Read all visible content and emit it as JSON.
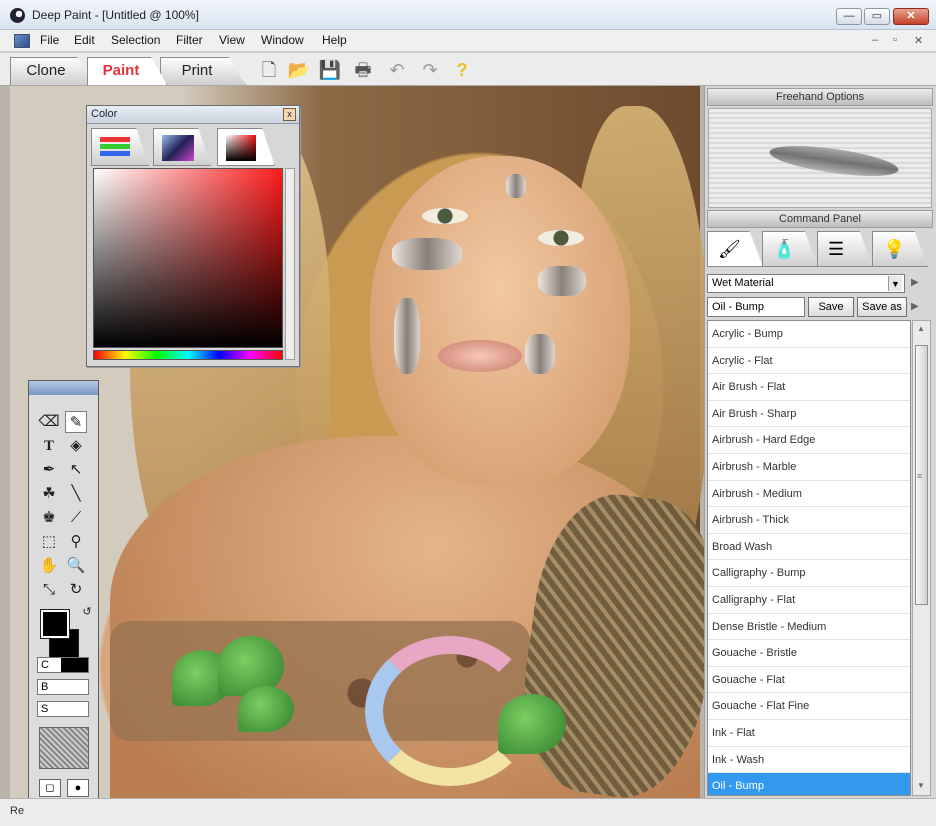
{
  "window": {
    "title": "Deep Paint - [Untitled @ 100%]",
    "minimize_label": "—",
    "maximize_label": "▭",
    "close_label": "✕"
  },
  "menu": {
    "items": [
      "File",
      "Edit",
      "Selection",
      "Filter",
      "View",
      "Window",
      "Help"
    ],
    "mdi_controls": [
      "–",
      "▫",
      "✕"
    ]
  },
  "tabs": [
    {
      "label": "Clone",
      "active": false
    },
    {
      "label": "Paint",
      "active": true
    },
    {
      "label": "Print",
      "active": false
    }
  ],
  "toolbar_icons": [
    "new-document-icon",
    "open-folder-icon",
    "save-icon",
    "print-icon",
    "undo-icon",
    "redo-icon",
    "help-icon"
  ],
  "color_panel": {
    "title": "Color",
    "close_label": "x",
    "tabs": [
      "rgb-sliders-icon",
      "color-wheel-icon",
      "color-square-icon"
    ]
  },
  "tools_panel": {
    "tools": [
      "eraser-icon",
      "brush-icon",
      "text-icon",
      "fill-bucket-icon",
      "pen-icon",
      "arrow-select-icon",
      "smudge-icon",
      "line-icon",
      "stamp-icon",
      "eyedropper-icon",
      "marquee-icon",
      "wand-icon",
      "hand-icon",
      "zoom-icon",
      "transform-icon",
      "rotate-icon"
    ],
    "sliders": [
      {
        "label": "C",
        "value": 0.55
      },
      {
        "label": "B",
        "value": 0
      },
      {
        "label": "S",
        "value": 0
      }
    ],
    "foreground": "#000000",
    "background": "#000000"
  },
  "right_panel": {
    "freehand_title": "Freehand Options",
    "command_title": "Command Panel",
    "command_tabs": [
      "brush-icon",
      "paint-tube-icon",
      "layers-icon",
      "lightbulb-icon"
    ],
    "material_dropdown": "Wet Material",
    "preset_name": "Oil - Bump",
    "save_label": "Save",
    "save_as_label": "Save as",
    "brushes": [
      "Acrylic - Bump",
      "Acrylic - Flat",
      "Air Brush - Flat",
      "Air Brush - Sharp",
      "Airbrush - Hard Edge",
      "Airbrush - Marble",
      "Airbrush - Medium",
      "Airbrush - Thick",
      "Broad Wash",
      "Calligraphy - Bump",
      "Calligraphy - Flat",
      "Dense Bristle - Medium",
      "Gouache - Bristle",
      "Gouache - Flat",
      "Gouache - Flat Fine",
      "Ink - Flat",
      "Ink - Wash",
      "Oil - Bump"
    ],
    "selected_brush": "Oil - Bump"
  },
  "status": {
    "text": "Re"
  }
}
